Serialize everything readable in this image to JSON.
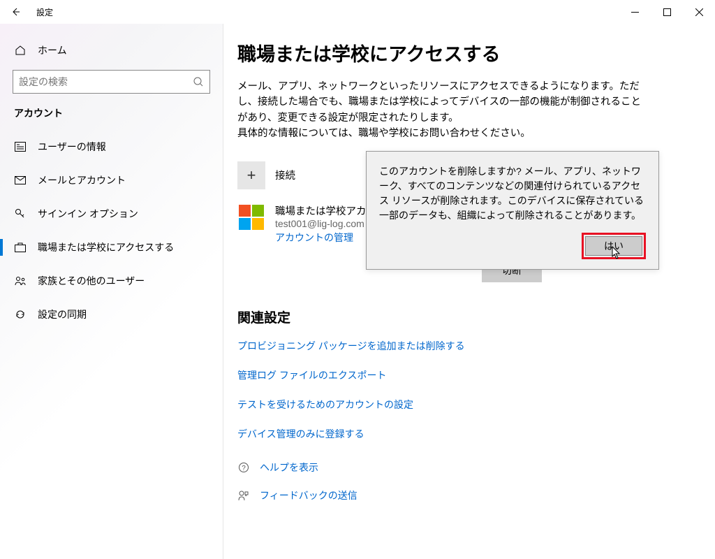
{
  "titlebar": {
    "title": "設定"
  },
  "sidebar": {
    "home": "ホーム",
    "search_placeholder": "設定の検索",
    "section": "アカウント",
    "items": [
      {
        "label": "ユーザーの情報"
      },
      {
        "label": "メールとアカウント"
      },
      {
        "label": "サインイン オプション"
      },
      {
        "label": "職場または学校にアクセスする"
      },
      {
        "label": "家族とその他のユーザー"
      },
      {
        "label": "設定の同期"
      }
    ]
  },
  "main": {
    "title": "職場または学校にアクセスする",
    "description": "メール、アプリ、ネットワークといったリソースにアクセスできるようになります。ただし、接続した場合でも、職場または学校によってデバイスの一部の機能が制御されることがあり、変更できる設定が限定されたりします。\n具体的な情報については、職場や学校にお問い合わせください。",
    "connect": "接続",
    "account": {
      "title": "職場または学校アカウ",
      "email": "test001@lig-log.com",
      "manage": "アカウントの管理"
    },
    "disconnect": "切断",
    "related_title": "関連設定",
    "links": [
      "プロビジョニング パッケージを追加または削除する",
      "管理ログ ファイルのエクスポート",
      "テストを受けるためのアカウントの設定",
      "デバイス管理のみに登録する"
    ],
    "help": "ヘルプを表示",
    "feedback": "フィードバックの送信"
  },
  "dialog": {
    "text": "このアカウントを削除しますか? メール、アプリ、ネットワーク、すべてのコンテンツなどの関連付けられているアクセス リソースが削除されます。このデバイスに保存されている一部のデータも、組織によって削除されることがあります。",
    "yes": "はい"
  },
  "colors": {
    "accent": "#0078d4",
    "link": "#0066cc",
    "highlight": "#e81123"
  }
}
